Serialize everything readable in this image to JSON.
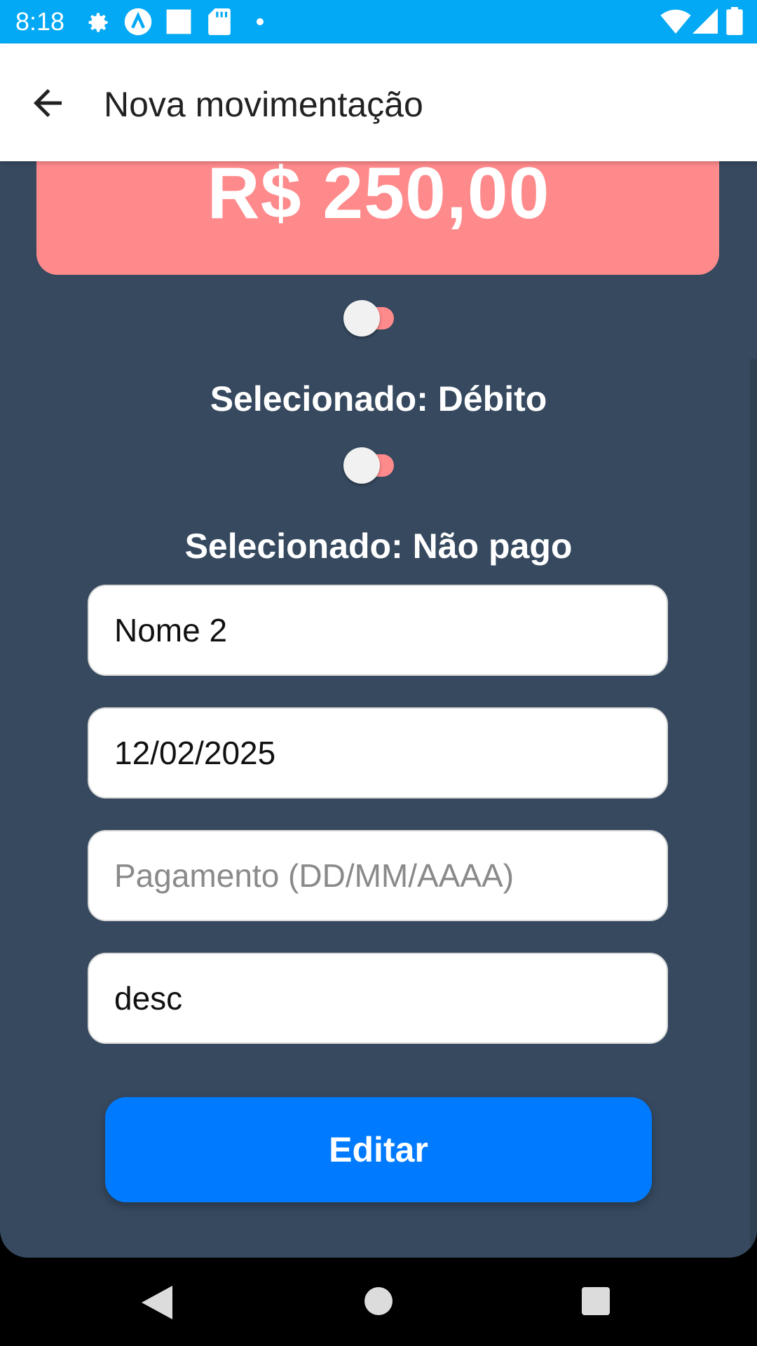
{
  "status_bar": {
    "time": "8:18",
    "left_icons": [
      "gear-icon",
      "a-circle-icon",
      "square-icon",
      "sd-card-icon",
      "dot-icon"
    ],
    "right_icons": [
      "wifi-icon",
      "signal-icon",
      "battery-icon"
    ],
    "color": "#03A9F4"
  },
  "app_bar": {
    "title": "Nova movimentação",
    "back_icon": "arrow-back-icon"
  },
  "amount": {
    "value": "R$ 250,00",
    "card_color": "#FF8A8C"
  },
  "toggles": [
    {
      "label": "Selecionado: Débito",
      "on": false
    },
    {
      "label": "Selecionado: Não pago",
      "on": false
    }
  ],
  "fields": {
    "name": {
      "value": "Nome 2",
      "placeholder": ""
    },
    "date": {
      "value": "12/02/2025",
      "placeholder": ""
    },
    "payment": {
      "value": "",
      "placeholder": "Pagamento (DD/MM/AAAA)"
    },
    "description": {
      "value": "desc",
      "placeholder": ""
    }
  },
  "edit_button": {
    "label": "Editar",
    "color": "#007BFF"
  },
  "nav_bar": {
    "icons": [
      "back-triangle-icon",
      "home-circle-icon",
      "recents-square-icon"
    ]
  },
  "colors": {
    "background": "#36495F",
    "accent": "#007BFF"
  }
}
